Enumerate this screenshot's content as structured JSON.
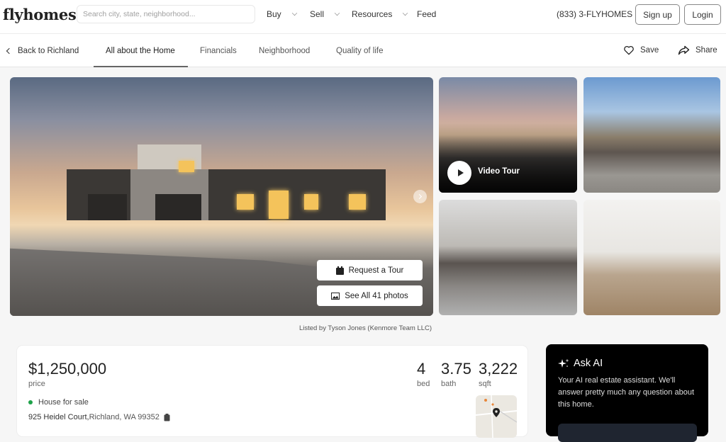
{
  "header": {
    "logo": "flyhomes",
    "search_placeholder": "Search city, state, neighborhood...",
    "nav": [
      {
        "label": "Buy",
        "has_dropdown": true
      },
      {
        "label": "Sell",
        "has_dropdown": true
      },
      {
        "label": "Resources",
        "has_dropdown": true
      },
      {
        "label": "Feed",
        "has_dropdown": false
      }
    ],
    "phone": "(833) 3-FLYHOMES",
    "signup_label": "Sign up",
    "login_label": "Login"
  },
  "subnav": {
    "back_label": "Back to Richland",
    "tabs": [
      {
        "label": "All about the Home",
        "active": true
      },
      {
        "label": "Financials",
        "active": false
      },
      {
        "label": "Neighborhood",
        "active": false
      },
      {
        "label": "Quality of life",
        "active": false
      }
    ],
    "save_label": "Save",
    "share_label": "Share"
  },
  "gallery": {
    "request_tour_label": "Request a Tour",
    "see_all_label": "See All 41 photos",
    "video_tour_label": "Video Tour",
    "listed_by": "Listed by Tyson Jones (Kenmore Team LLC)"
  },
  "listing": {
    "price": "$1,250,000",
    "price_label": "price",
    "status": "House for sale",
    "status_color": "#1fa24a",
    "address_street": "925 Heidel Court,",
    "address_city": " Richland, WA 99352",
    "stats": [
      {
        "value": "4",
        "label": "bed"
      },
      {
        "value": "3.75",
        "label": "bath"
      },
      {
        "value": "3,222",
        "label": "sqft"
      }
    ]
  },
  "ask_ai": {
    "title": "Ask AI",
    "description": "Your AI real estate assistant. We'll answer pretty much any question about this home."
  }
}
